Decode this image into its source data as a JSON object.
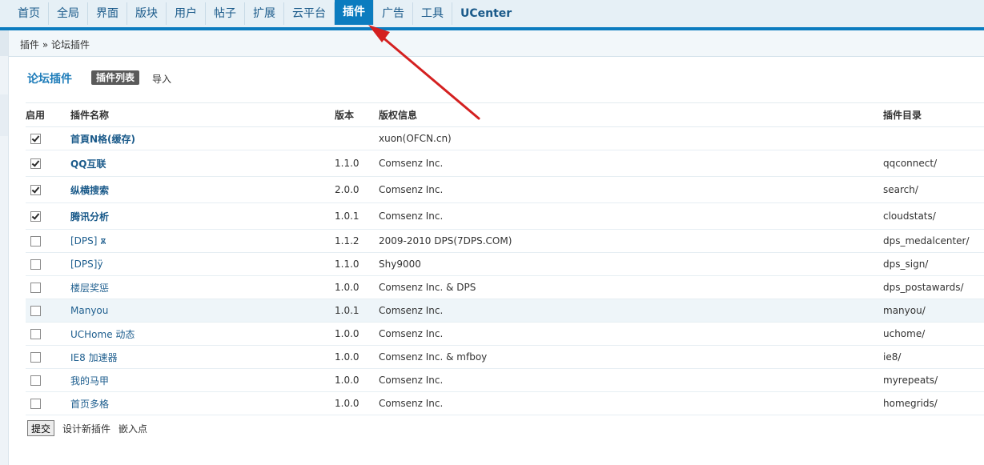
{
  "topnav": {
    "items": [
      "首页",
      "全局",
      "界面",
      "版块",
      "用户",
      "帖子",
      "扩展",
      "云平台",
      "插件",
      "广告",
      "工具",
      "UCenter"
    ],
    "active_index": 8
  },
  "breadcrumb": {
    "text": "插件 » 论坛插件"
  },
  "section": {
    "title": "论坛插件",
    "tabs": [
      "插件列表",
      "导入"
    ]
  },
  "table": {
    "headers": [
      "启用",
      "插件名称",
      "版本",
      "版权信息",
      "插件目录"
    ],
    "rows": [
      {
        "enabled": true,
        "name": "首頁N格(缓存)",
        "bold": true,
        "version": "",
        "copyright": "xuon(OFCN.cn)",
        "dir": ""
      },
      {
        "enabled": true,
        "name": "QQ互联",
        "bold": true,
        "version": "1.1.0",
        "copyright": "Comsenz Inc.",
        "dir": "qqconnect/"
      },
      {
        "enabled": true,
        "name": "纵横搜索",
        "bold": true,
        "version": "2.0.0",
        "copyright": "Comsenz Inc.",
        "dir": "search/"
      },
      {
        "enabled": true,
        "name": "腾讯分析",
        "bold": true,
        "version": "1.0.1",
        "copyright": "Comsenz Inc.",
        "dir": "cloudstats/"
      },
      {
        "enabled": false,
        "name": "[DPS] ѫ",
        "bold": false,
        "version": "1.1.2",
        "copyright": "2009-2010 DPS(7DPS.COM)",
        "dir": "dps_medalcenter/"
      },
      {
        "enabled": false,
        "name": "[DPS]ÿ",
        "bold": false,
        "version": "1.1.0",
        "copyright": "Shy9000",
        "dir": "dps_sign/"
      },
      {
        "enabled": false,
        "name": "楼层奖惩",
        "bold": false,
        "version": "1.0.0",
        "copyright": "Comsenz Inc. & DPS",
        "dir": "dps_postawards/"
      },
      {
        "enabled": false,
        "name": "Manyou",
        "bold": false,
        "version": "1.0.1",
        "copyright": "Comsenz Inc.",
        "dir": "manyou/"
      },
      {
        "enabled": false,
        "name": "UCHome 动态",
        "bold": false,
        "version": "1.0.0",
        "copyright": "Comsenz Inc.",
        "dir": "uchome/"
      },
      {
        "enabled": false,
        "name": "IE8 加速器",
        "bold": false,
        "version": "1.0.0",
        "copyright": "Comsenz Inc. & mfboy",
        "dir": "ie8/"
      },
      {
        "enabled": false,
        "name": "我的马甲",
        "bold": false,
        "version": "1.0.0",
        "copyright": "Comsenz Inc.",
        "dir": "myrepeats/"
      },
      {
        "enabled": false,
        "name": "首页多格",
        "bold": false,
        "version": "1.0.0",
        "copyright": "Comsenz Inc.",
        "dir": "homegrids/"
      }
    ],
    "highlight_row": 7
  },
  "footer": {
    "submit_label": "提交",
    "links": [
      "设计新插件",
      "嵌入点"
    ]
  },
  "annotation": {
    "arrow_color": "#d42020"
  }
}
